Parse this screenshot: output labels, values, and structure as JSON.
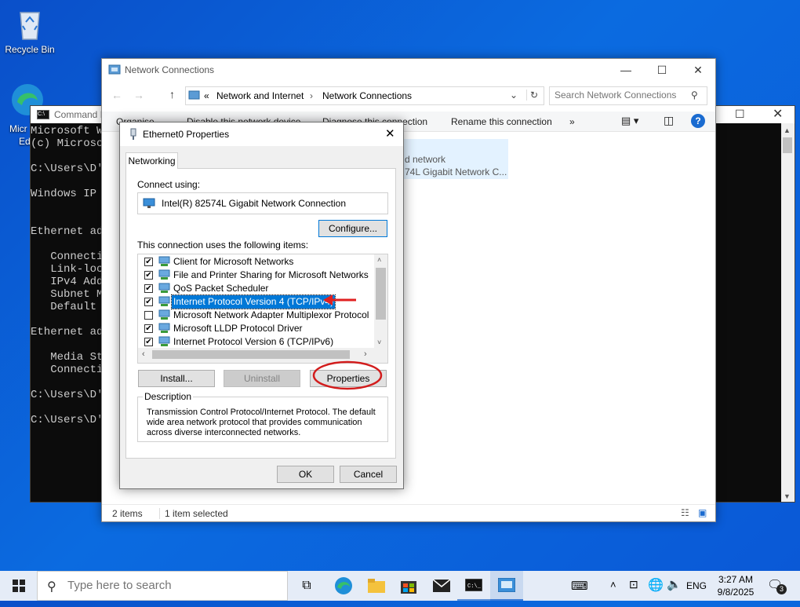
{
  "desktop": {
    "recycle_bin_label": "Recycle Bin",
    "edge_label_part1": "Micr",
    "edge_label_part2": "Ed"
  },
  "cmd": {
    "title": "Command P",
    "lines": "Microsoft W\n(c) Microso\n\nC:\\Users\\D'\n\nWindows IP C\n\n\nEthernet ada\n\n   Connectio\n   Link-loca\n   IPv4 Addr\n   Subnet Ma\n   Default G\n\nEthernet ada\n\n   Media Sta\n   Connectio\n\nC:\\Users\\D'\n\nC:\\Users\\D'"
  },
  "explorer": {
    "title": "Network Connections",
    "breadcrumb": {
      "prefix": "«",
      "part1": "Network and Internet",
      "part2": "Network Connections"
    },
    "search_placeholder": "Search Network Connections",
    "commands": {
      "organise": "Organise",
      "disable": "Disable this network device",
      "diagnose": "Diagnose this connection",
      "rename": "Rename this connection",
      "more": "»"
    },
    "item_partial_line1": "d network",
    "item_partial_line2": "74L Gigabit Network C...",
    "status": {
      "items": "2 items",
      "selected": "1 item selected"
    }
  },
  "dialog": {
    "title": "Ethernet0 Properties",
    "tab": "Networking",
    "connect_using_label": "Connect using:",
    "adapter": "Intel(R) 82574L Gigabit Network Connection",
    "configure": "Configure...",
    "items_label": "This connection uses the following items:",
    "items": [
      {
        "label": "Client for Microsoft Networks",
        "checked": true
      },
      {
        "label": "File and Printer Sharing for Microsoft Networks",
        "checked": true
      },
      {
        "label": "QoS Packet Scheduler",
        "checked": true
      },
      {
        "label": "Internet Protocol Version 4 (TCP/IPv4)",
        "checked": true,
        "selected": true
      },
      {
        "label": "Microsoft Network Adapter Multiplexor Protocol",
        "checked": false
      },
      {
        "label": "Microsoft LLDP Protocol Driver",
        "checked": true
      },
      {
        "label": "Internet Protocol Version 6 (TCP/IPv6)",
        "checked": true
      }
    ],
    "install": "Install...",
    "uninstall": "Uninstall",
    "properties": "Properties",
    "description_label": "Description",
    "description": "Transmission Control Protocol/Internet Protocol. The default wide area network protocol that provides communication across diverse interconnected networks.",
    "ok": "OK",
    "cancel": "Cancel",
    "check_mark": "✔"
  },
  "taskbar": {
    "search_placeholder": "Type here to search",
    "language": "ENG",
    "time": "3:27 AM",
    "date": "9/8/2025",
    "notification_count": "3"
  },
  "colors": {
    "accent": "#0078d7",
    "annotation_red": "#e02020"
  }
}
